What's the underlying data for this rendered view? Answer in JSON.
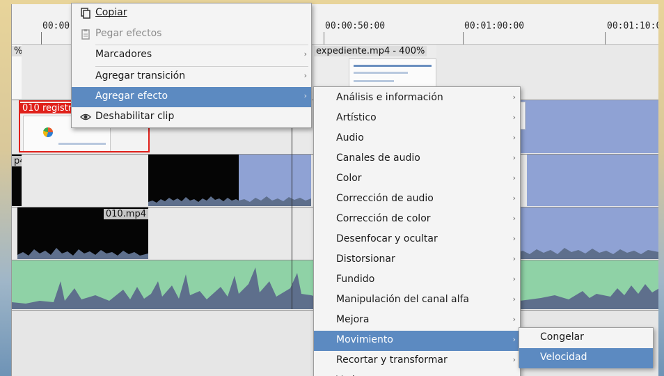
{
  "timeline": {
    "ruler": [
      "00:00",
      "00:00:50:00",
      "00:01:00:00",
      "00:01:10:0"
    ],
    "clips": {
      "v1_pct": "%",
      "v1_expediente": "expediente.mp4 - 400%",
      "v2_registro": "010 registr",
      "a1_mp4": "p4",
      "a2_mp4": "010.mp4"
    }
  },
  "context_menu": {
    "items": [
      {
        "label": "Copiar",
        "icon": "copy-icon",
        "enabled": true
      },
      {
        "label": "Pegar efectos",
        "icon": "paste-icon",
        "enabled": false
      },
      {
        "label": "Marcadores",
        "submenu": true
      },
      {
        "label": "Agregar transición",
        "submenu": true
      },
      {
        "label": "Agregar efecto",
        "submenu": true,
        "selected": true
      },
      {
        "label": "Deshabilitar clip",
        "icon": "eye-icon",
        "enabled": true
      }
    ]
  },
  "effects_menu": {
    "items": [
      "Análisis e información",
      "Artístico",
      "Audio",
      "Canales de audio",
      "Color",
      "Corrección de audio",
      "Corrección de color",
      "Desenfocar y ocultar",
      "Distorsionar",
      "Fundido",
      "Manipulación del canal alfa",
      "Mejora",
      "Movimiento",
      "Recortar y transformar",
      "Varios"
    ],
    "selected": "Movimiento"
  },
  "motion_menu": {
    "items": [
      "Congelar",
      "Velocidad"
    ],
    "selected": "Velocidad"
  },
  "colors": {
    "selection": "#5c8ac1",
    "clip_blue": "#8fa2d4",
    "audio_green": "#8fd2a6",
    "clip_selected_border": "#e0201a"
  }
}
